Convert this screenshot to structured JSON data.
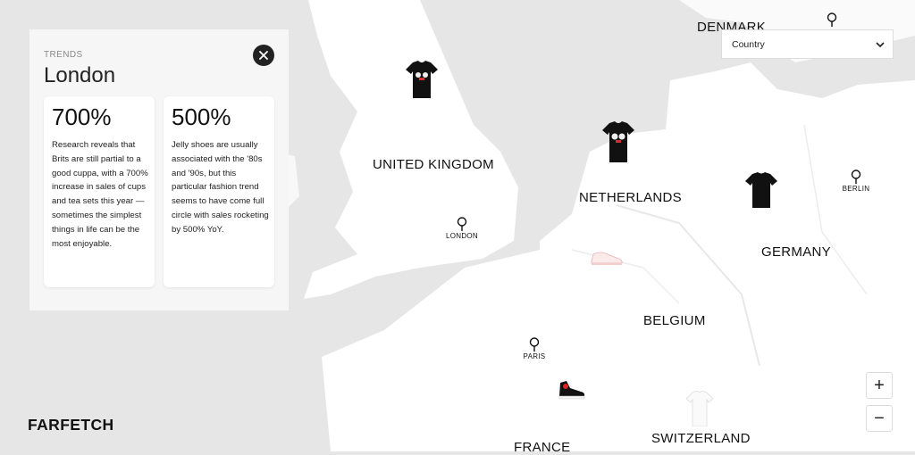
{
  "map": {
    "countries": [
      {
        "key": "denmark",
        "label": "DENMARK"
      },
      {
        "key": "united-kingdom",
        "label": "UNITED KINGDOM"
      },
      {
        "key": "netherlands",
        "label": "NETHERLANDS"
      },
      {
        "key": "germany",
        "label": "GERMANY"
      },
      {
        "key": "belgium",
        "label": "BELGIUM"
      },
      {
        "key": "switzerland",
        "label": "SWITZERLAND"
      },
      {
        "key": "france",
        "label": "FRANCE"
      }
    ],
    "cities": [
      {
        "key": "london",
        "label": "LONDON"
      },
      {
        "key": "paris",
        "label": "PARIS"
      },
      {
        "key": "berlin",
        "label": "BERLIN"
      }
    ],
    "products": [
      "tshirt-icon",
      "tshirt-icon",
      "tshirt-icon",
      "sneaker-icon",
      "sneaker-icon",
      "tshirt-icon"
    ]
  },
  "trends": {
    "eyebrow": "TRENDS",
    "city": "London",
    "cards": [
      {
        "stat": "700%",
        "text": "Research reveals that Brits are still partial to a good cuppa, with a 700% increase in sales of cups and tea sets this year — sometimes the simplest things in life can be the most enjoyable."
      },
      {
        "stat": "500%",
        "text": "Jelly shoes are usually associated with the '80s and '90s, but this particular fashion trend seems to have come full circle with sales rocketing by 500% YoY."
      }
    ]
  },
  "country_select": {
    "selected": "Country"
  },
  "zoom": {
    "in": "+",
    "out": "−"
  },
  "brand": {
    "logo": "FARFETCH"
  },
  "colors": {
    "land": "#ffffff",
    "water": "#e6e6e6",
    "panel": "#f6f6f6",
    "accent": "#222222"
  }
}
